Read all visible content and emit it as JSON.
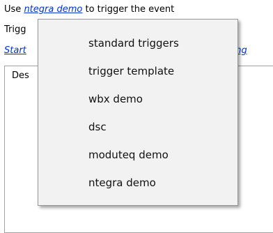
{
  "rule_editor": {
    "line1": {
      "prefix": "Use",
      "link": "ntegra demo",
      "suffix": "to trigger the event"
    },
    "line2": {
      "prefix": "Trigg"
    },
    "line3": {
      "link_left": "Start",
      "link_right": "wing"
    },
    "description_label": "Des"
  },
  "dropdown": {
    "items": [
      "standard triggers",
      "trigger template",
      "wbx demo",
      "dsc",
      "moduteq demo",
      "ntegra demo"
    ]
  }
}
